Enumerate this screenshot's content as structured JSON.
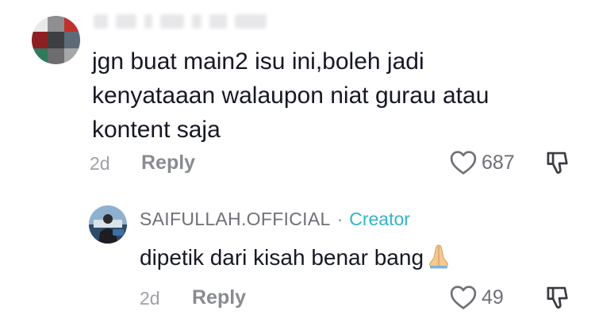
{
  "comment": {
    "text": "jgn buat main2 isu ini,boleh jadi\nkenyataaan walaupon niat gurau atau\nkontent saja",
    "time": "2d",
    "reply_label": "Reply",
    "likes": "687",
    "like_icon": "heart-outline-icon",
    "dislike_icon": "thumbs-down-icon",
    "avatar_colors": [
      "#e9e9ea",
      "#8f8f91",
      "#c1312b",
      "#8d1f22",
      "#3f3f42",
      "#5d6b79",
      "#2e7a5c",
      "#6d6d70",
      "#a7a7aa"
    ]
  },
  "reply": {
    "author": "SAIFULLAH.OFFICIAL",
    "separator": "·",
    "badge": "Creator",
    "text": "dipetik dari kisah benar bang",
    "emoji_icon": "praying-hands-icon",
    "time": "2d",
    "reply_label": "Reply",
    "likes": "49"
  },
  "colors": {
    "text": "#161823",
    "muted": "#8a8b91",
    "creator": "#2fb6c5"
  }
}
